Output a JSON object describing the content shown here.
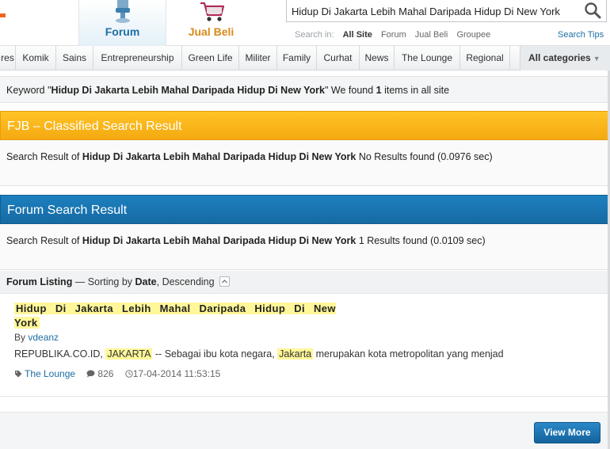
{
  "header": {
    "tabs": [
      {
        "label": "Forum",
        "icon": "forum-podium-icon",
        "color": "#1c6ea4"
      },
      {
        "label": "Jual Beli",
        "icon": "shopping-cart-icon",
        "color": "#d98a1a"
      }
    ],
    "search": {
      "value": "Hidup Di Jakarta Lebih Mahal Daripada Hidup Di New York",
      "icon": "search-icon"
    },
    "search_in": {
      "label": "Search in:",
      "options": [
        {
          "label": "All Site",
          "active": true
        },
        {
          "label": "Forum",
          "active": false
        },
        {
          "label": "Jual Beli",
          "active": false
        },
        {
          "label": "Groupee",
          "active": false
        }
      ]
    },
    "search_tips": "Search Tips"
  },
  "categories": [
    "res",
    "Komik",
    "Sains",
    "Entrepreneurship",
    "Green Life",
    "Militer",
    "Family",
    "Curhat",
    "News",
    "The Lounge",
    "Regional"
  ],
  "all_categories": "All categories",
  "keyword_bar": {
    "prefix": "Keyword \"",
    "keyword": "Hidup Di Jakarta Lebih Mahal Daripada Hidup Di New York",
    "mid": "\" We found ",
    "count": "1",
    "suffix": " items in all site"
  },
  "fjb": {
    "title": "FJB – Classified Search Result",
    "prefix": "Search Result of ",
    "keyword": "Hidup Di Jakarta Lebih Mahal Daripada Hidup Di New York",
    "status": "  No Results found (0.0976 sec)",
    "color": "#f7b01a"
  },
  "forum": {
    "title": "Forum Search Result",
    "prefix": "Search Result of ",
    "keyword": "Hidup Di Jakarta Lebih Mahal Daripada Hidup Di New York",
    "status": " 1 Results found (0.0109 sec)",
    "color": "#1a75b1",
    "listing": {
      "label": "Forum Listing",
      "sep": " — Sorting by ",
      "sort_field": "Date",
      "sort_dir": ", Descending"
    },
    "results": [
      {
        "title": "Hidup Di Jakarta Lebih Mahal Daripada Hidup Di New York",
        "by_label": "By ",
        "author": "vdeanz",
        "snippet_1": "REPUBLIKA.CO.ID, ",
        "snippet_hl_1": "JAKARTA",
        "snippet_2": " -- Sebagai ibu kota negara, ",
        "snippet_hl_2": "Jakarta",
        "snippet_3": " merupakan kota metropolitan yang menjad",
        "category": "The Lounge",
        "replies": "826",
        "date": "17-04-2014 11:53:15"
      }
    ],
    "view_more": "View More"
  },
  "colors": {
    "highlight": "#fff799",
    "link": "#1c6ea4"
  }
}
